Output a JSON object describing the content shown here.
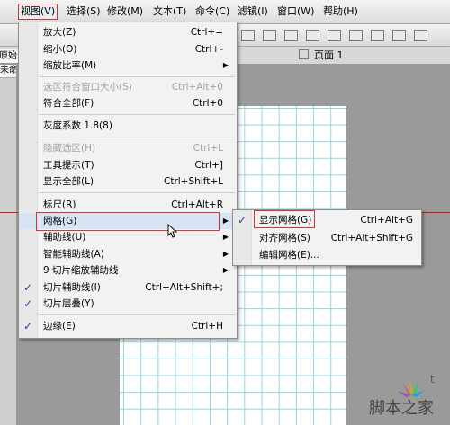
{
  "menubar": {
    "items": [
      {
        "label": "视图(V)",
        "active": true
      },
      {
        "label": "选择(S)"
      },
      {
        "label": "修改(M)"
      },
      {
        "label": "文本(T)"
      },
      {
        "label": "命令(C)"
      },
      {
        "label": "滤镜(I)"
      },
      {
        "label": "窗口(W)"
      },
      {
        "label": "帮助(H)"
      }
    ]
  },
  "left_tabs": {
    "top": "原始",
    "second": "未命名"
  },
  "page_tab": {
    "label": "页面 1"
  },
  "view_menu": {
    "items": [
      {
        "label": "放大(Z)",
        "shortcut": "Ctrl+="
      },
      {
        "label": "缩小(O)",
        "shortcut": "Ctrl+-"
      },
      {
        "label": "缩放比率(M)",
        "submenu": true
      },
      {
        "label": "选区符合窗口大小(S)",
        "shortcut": "Ctrl+Alt+0",
        "disabled": true
      },
      {
        "label": "符合全部(F)",
        "shortcut": "Ctrl+0"
      },
      {
        "label": "灰度系数 1.8(8)"
      },
      {
        "label": "隐藏选区(H)",
        "shortcut": "Ctrl+L",
        "disabled": true
      },
      {
        "label": "工具提示(T)",
        "shortcut": "Ctrl+]"
      },
      {
        "label": "显示全部(L)",
        "shortcut": "Ctrl+Shift+L"
      },
      {
        "label": "标尺(R)",
        "shortcut": "Ctrl+Alt+R"
      },
      {
        "label": "网格(G)",
        "submenu": true,
        "highlighted": true
      },
      {
        "label": "辅助线(U)",
        "submenu": true
      },
      {
        "label": "智能辅助线(A)",
        "submenu": true
      },
      {
        "label": "9 切片缩放辅助线",
        "submenu": true
      },
      {
        "label": "切片辅助线(I)",
        "shortcut": "Ctrl+Alt+Shift+;",
        "checked": true
      },
      {
        "label": "切片层叠(Y)",
        "checked": true
      },
      {
        "label": "边缘(E)",
        "shortcut": "Ctrl+H",
        "checked": true
      }
    ]
  },
  "grid_submenu": {
    "items": [
      {
        "label": "显示网格(G)",
        "shortcut": "Ctrl+Alt+G",
        "checked": true
      },
      {
        "label": "对齐网格(S)",
        "shortcut": "Ctrl+Alt+Shift+G"
      },
      {
        "label": "编辑网格(E)..."
      }
    ]
  },
  "icons": {
    "check": "✓",
    "submenu_arrow": "▶"
  },
  "watermark": {
    "text": "脚本之家",
    "corner_letter": "t"
  },
  "colors": {
    "highlight_box": "#e03131",
    "guide_line": "#d11111",
    "grid": "#8fd7e0",
    "menu_bg": "#f2f2f2"
  }
}
